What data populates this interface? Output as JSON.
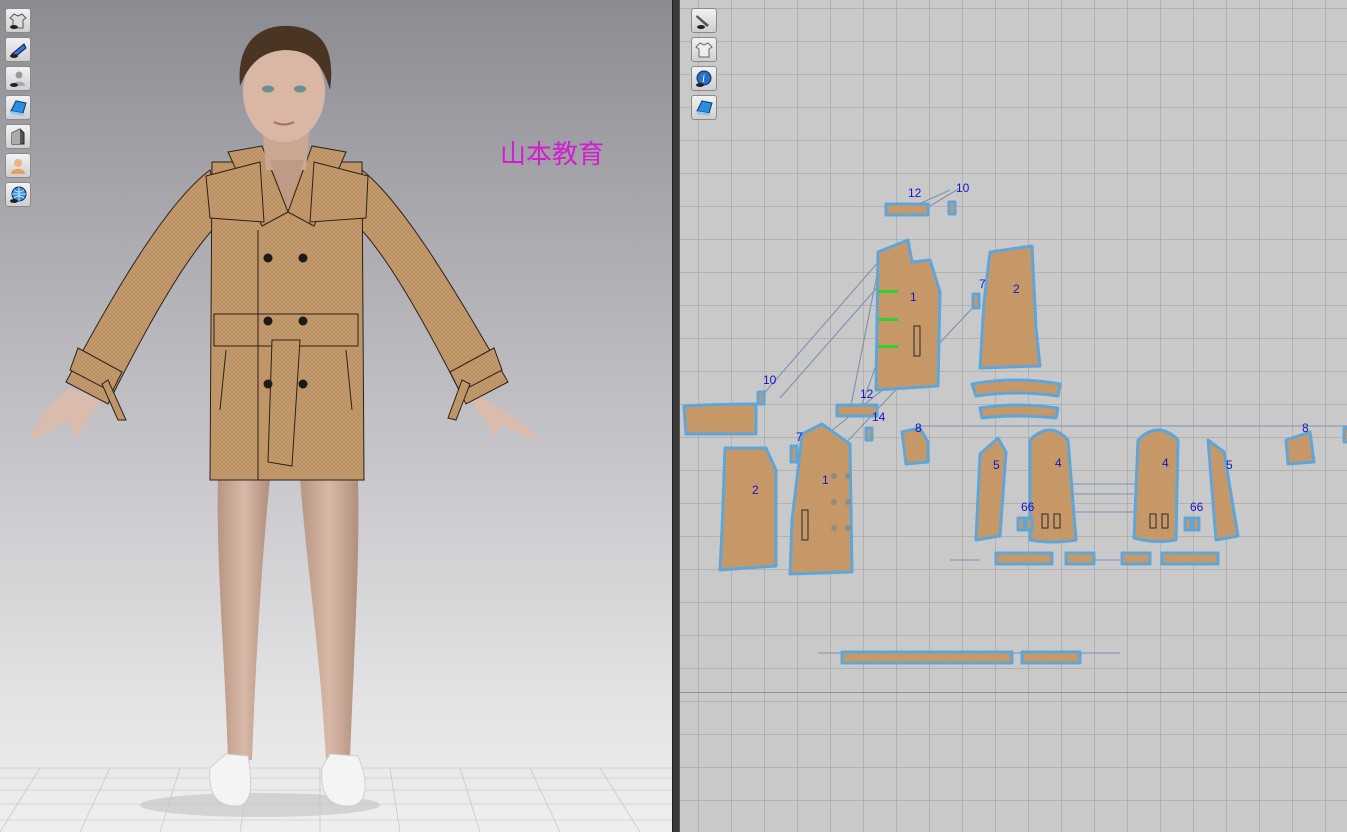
{
  "watermark": "山本教育",
  "toolbar_3d": [
    "show-garment-icon",
    "show-pattern-icon",
    "show-avatar-icon",
    "texture-view-icon",
    "shading-icon",
    "avatar-skin-icon",
    "show-grid-icon"
  ],
  "toolbar_2d": [
    "edit-pattern-icon",
    "show-garment-2d-icon",
    "info-icon",
    "texture-2d-icon"
  ],
  "pattern_labels": {
    "p12_top": "12",
    "p10_top": "10",
    "p1_front_top": "1",
    "p2_back_top": "2",
    "p7_top": "7",
    "p10_left": "10",
    "p12_mid": "12",
    "p14": "14",
    "p7_mid": "7",
    "p2_back_bottom": "2",
    "p1_front_bottom": "1",
    "p8_left": "8",
    "p5_left": "5",
    "p4_left": "4",
    "p66_left": "66",
    "p4_right": "4",
    "p66_right": "66",
    "p5_right": "5",
    "p8_right": "8"
  },
  "colors": {
    "fabric": "#c89a6a",
    "seam_outline": "#5ea6d9",
    "label": "#1515c8",
    "watermark": "#d21ed2",
    "grid_bg": "#c9c9c9"
  }
}
